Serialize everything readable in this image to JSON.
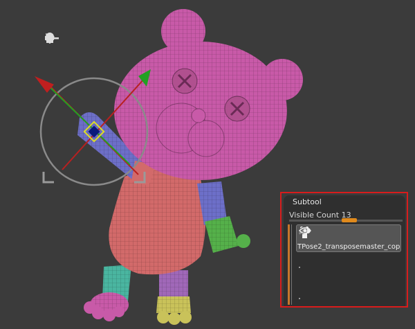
{
  "subtool": {
    "title": "Subtool",
    "visible_count_label": "Visible Count",
    "visible_count_value": "13",
    "items": [
      {
        "name": "TPose2_transposemaster_cop"
      }
    ]
  },
  "gizmo_toolbar": {
    "icons": [
      "gear-icon",
      "pin-icon",
      "location-icon",
      "home-icon",
      "reset-icon",
      "lock-icon",
      "key-icon"
    ]
  },
  "colors": {
    "highlight": "#d91c1c",
    "slider_thumb": "#e08a1c",
    "head": "#c85aa8",
    "body": "#d26a6a",
    "arm": "#6d6fc8",
    "leg_teal": "#4ab5a0",
    "foot_yellow": "#c9c25a",
    "hand_green": "#55b04a"
  }
}
